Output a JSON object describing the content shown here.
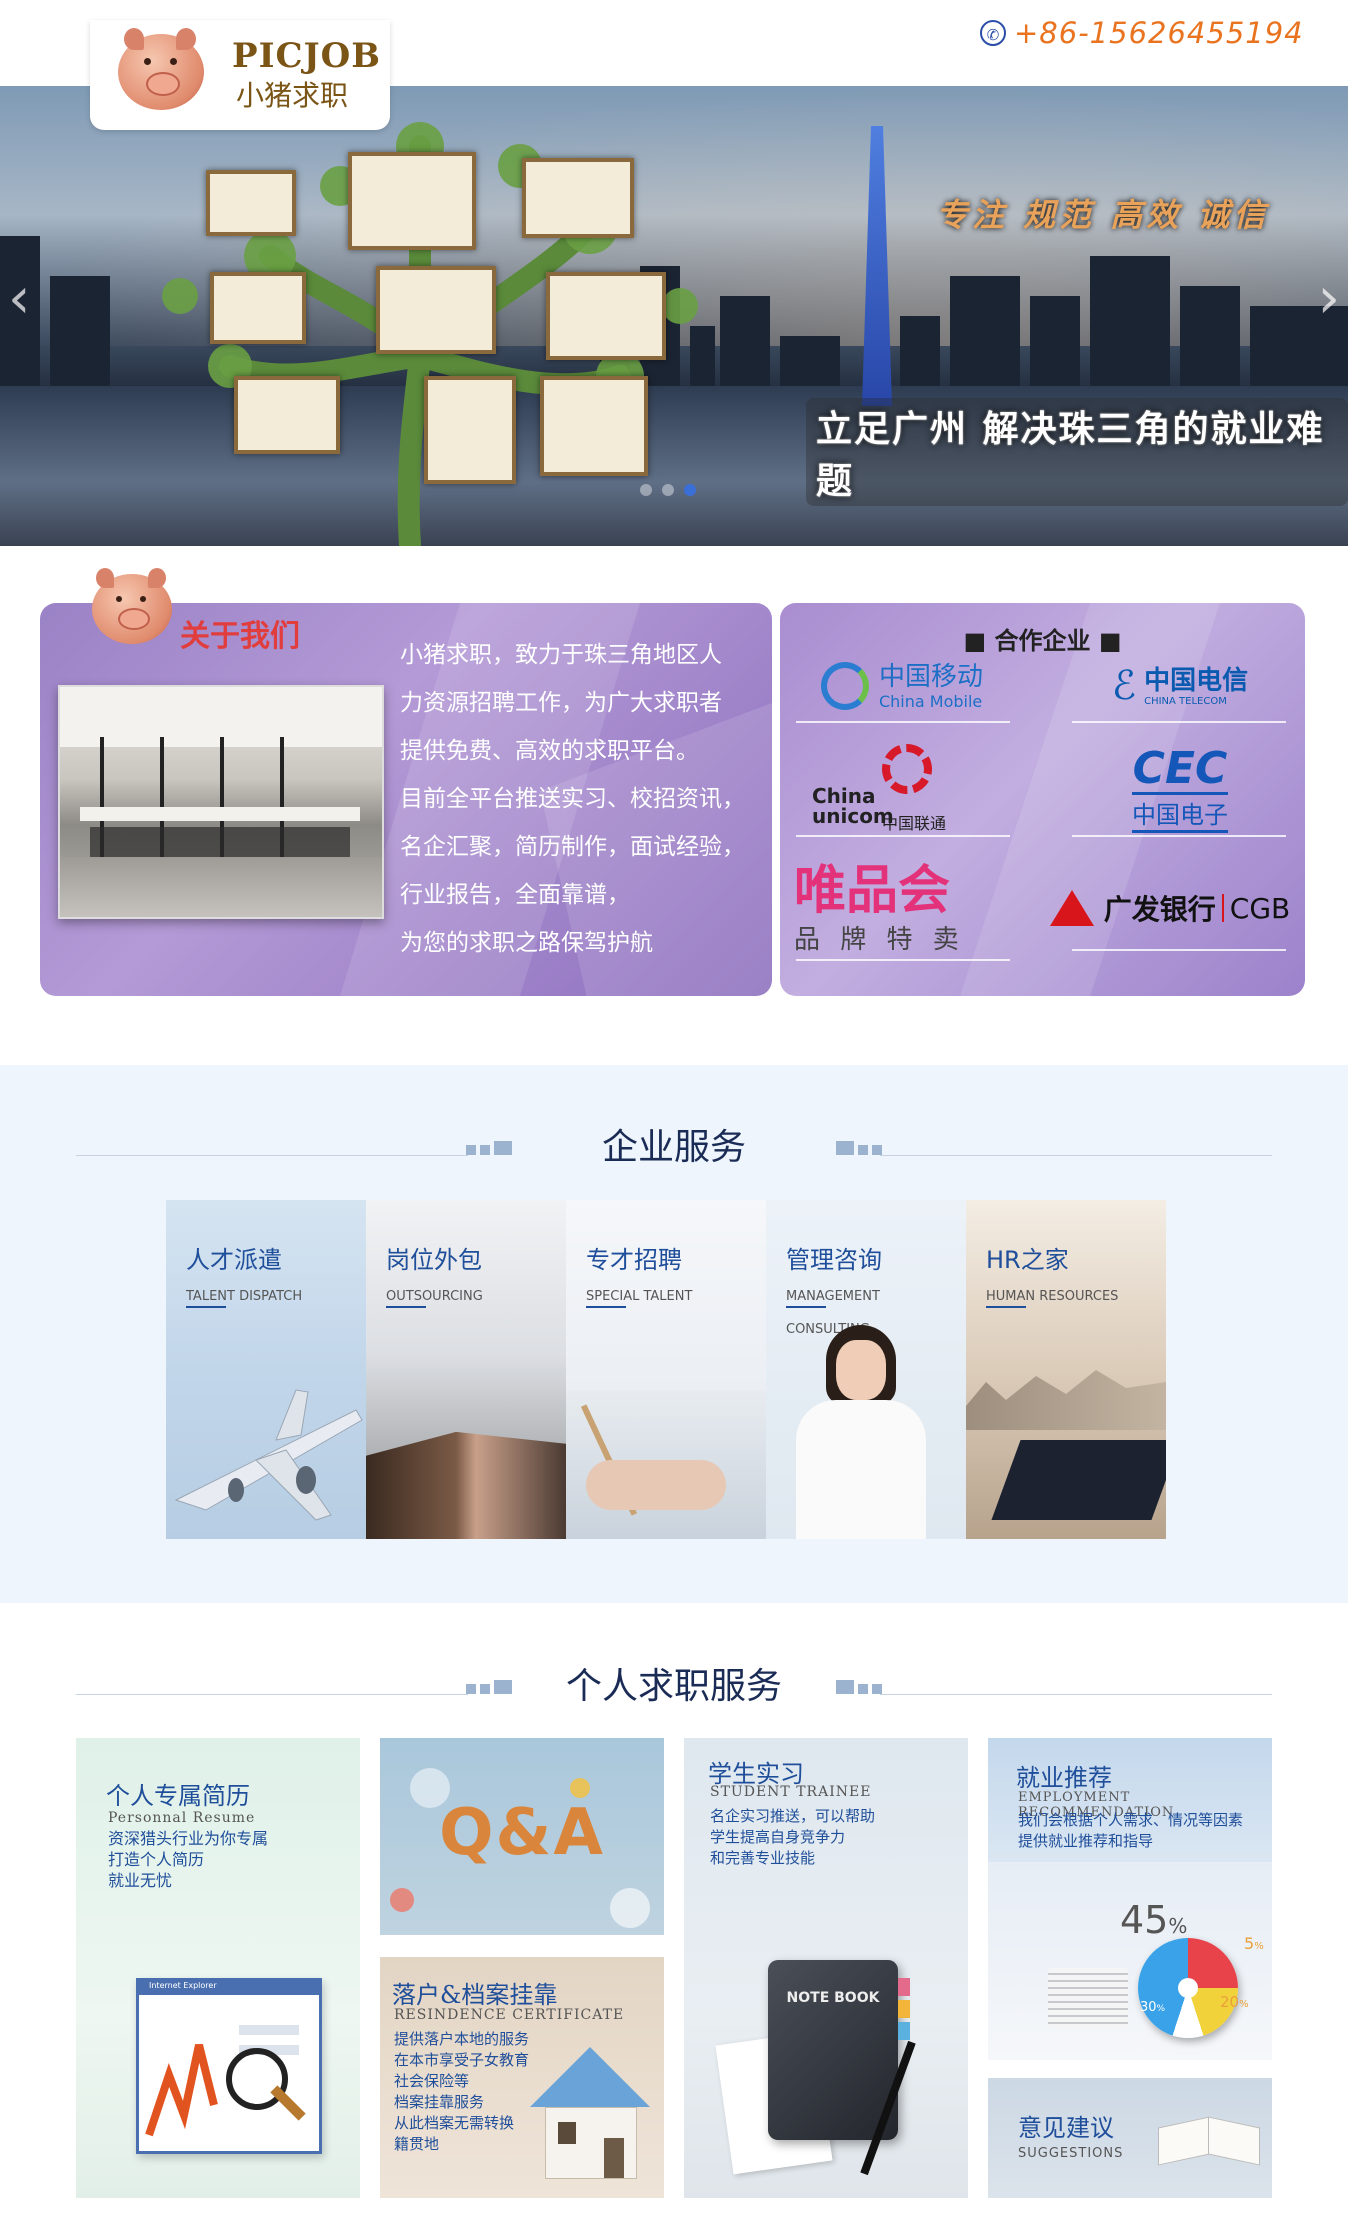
{
  "header": {
    "phone": "+86-15626455194",
    "logo_en": "PICJOB",
    "logo_cn": "小猪求职"
  },
  "banner": {
    "slogan_top": "专注 规范 高效 诚信",
    "slogan_bottom": "立足广州 解决珠三角的就业难题",
    "prev": "‹",
    "next": "›"
  },
  "about": {
    "title": "关于我们",
    "lines": [
      "小猪求职，致力于珠三角地区人",
      "力资源招聘工作，为广大求职者",
      "提供免费、高效的求职平台。",
      "目前全平台推送实习、校招资讯，",
      "名企汇聚，简历制作，面试经验，",
      "行业报告，全面靠谱，",
      "为您的求职之路保驾护航"
    ]
  },
  "partners": {
    "title": "■  合作企业  ■",
    "mobile_cn": "中国移动",
    "mobile_en": "China Mobile",
    "telecom_cn": "中国电信",
    "telecom_en": "CHINA TELECOM",
    "unicom_en1": "China",
    "unicom_en2": "unicom",
    "unicom_cn": "中国联通",
    "cec_en": "CEC",
    "cec_cn": "中国电子",
    "vip_cn": "唯品会",
    "vip_sub": "品 牌 特 卖",
    "cgb_cn": "广发银行",
    "cgb_en": "CGB"
  },
  "enterprise": {
    "title": "企业服务",
    "cards": [
      {
        "cn": "人才派遣",
        "en": "TALENT DISPATCH"
      },
      {
        "cn": "岗位外包",
        "en": "OUTSOURCING"
      },
      {
        "cn": "专才招聘",
        "en": "SPECIAL TALENT"
      },
      {
        "cn": "管理咨询",
        "en": "MANAGEMENT CONSULTING"
      },
      {
        "cn": "HR之家",
        "en": "HUMAN RESOURCES"
      }
    ]
  },
  "personal": {
    "title": "个人求职服务",
    "resume": {
      "title": "个人专属简历",
      "en": "Personnal Resume",
      "desc": [
        "资深猎头行业为你专属",
        "打造个人简历",
        "就业无忧"
      ],
      "browser": "Internet Explorer"
    },
    "qa": {
      "title": "Q&A"
    },
    "hukou": {
      "title": "落户&档案挂靠",
      "en": "RESINDENCE CERTIFICATE",
      "desc": [
        "提供落户本地的服务",
        "在本市享受子女教育",
        "社会保险等",
        "档案挂靠服务",
        "从此档案无需转换",
        "籍贯地"
      ]
    },
    "intern": {
      "title": "学生实习",
      "en": "STUDENT TRAINEE",
      "desc": [
        "名企实习推送，可以帮助",
        "学生提高自身竞争力",
        "和完善专业技能"
      ],
      "notebook": "NOTE BOOK"
    },
    "recommend": {
      "title": "就业推荐",
      "en": "EMPLOYMENT RECOMMENDATION",
      "desc": [
        "我们会根据个人需求、情况等因素",
        "提供就业推荐和指导"
      ],
      "pct_main": "45",
      "pct_a": "5",
      "pct_b": "20",
      "pct_c": "30",
      "pct_sign": "%"
    },
    "suggest": {
      "title": "意见建议",
      "en": "SUGGESTIONS"
    }
  }
}
